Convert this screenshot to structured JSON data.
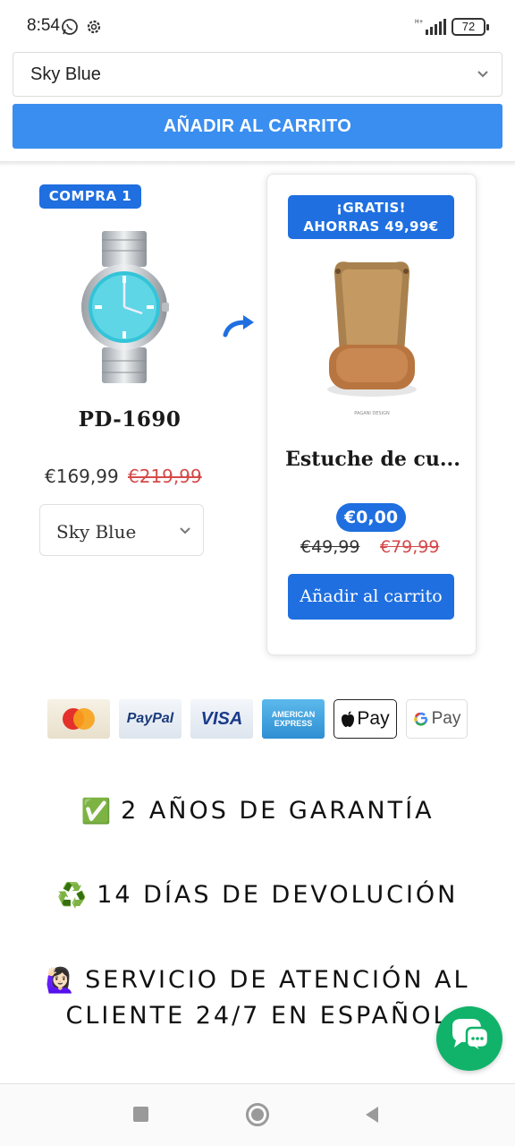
{
  "status_bar": {
    "time": "8:54",
    "battery": "72"
  },
  "top_bar": {
    "variant_selected": "Sky Blue",
    "cart_button": "AÑADIR AL CARRITO"
  },
  "bundle": {
    "main_product": {
      "badge": "COMPRA 1",
      "name": "PD-1690",
      "price": "€169,99",
      "compare_price": "€219,99",
      "variant_selected": "Sky Blue"
    },
    "gift": {
      "badge_line1": "¡GRATIS!",
      "badge_line2": "AHORRAS 49,99€",
      "name": "Estuche de cu...",
      "price": "€0,00",
      "original_price": "€49,99",
      "compare_price": "€79,99",
      "cart_button": "Añadir al carrito"
    }
  },
  "payments": {
    "paypal": "PayPal",
    "visa": "VISA",
    "amex_line1": "AMERICAN",
    "amex_line2": "EXPRESS",
    "apple_pay": "Pay",
    "google_pay": "Pay"
  },
  "guarantees": [
    {
      "emoji": "✅",
      "text": "2 AÑOS DE GARANTÍA"
    },
    {
      "emoji": "♻️",
      "text": "14 DÍAS DE DEVOLUCIÓN"
    },
    {
      "emoji": "🙋🏻‍♀️",
      "text": "SERVICIO DE ATENCIÓN AL CLIENTE 24/7 EN ESPAÑOL"
    }
  ],
  "colors": {
    "accent": "#1f6fe0",
    "top_button": "#3a8ef0",
    "strike_red": "#d44a4a",
    "chat": "#11b36a"
  }
}
